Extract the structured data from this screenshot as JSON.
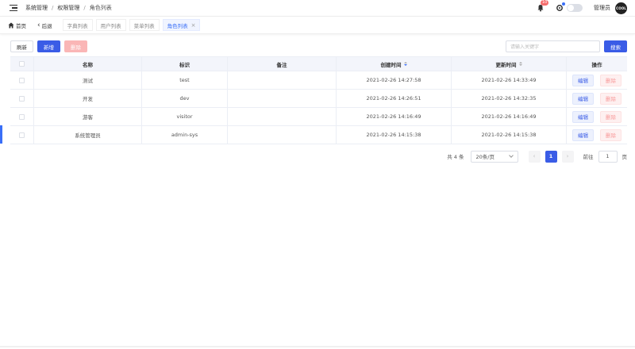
{
  "header": {
    "breadcrumb": [
      "系统管理",
      "权限管理",
      "角色列表"
    ],
    "notification_count": "10",
    "admin_name": "管理员",
    "avatar_text": "COOL"
  },
  "tabs": {
    "home": "首页",
    "back": "后退",
    "items": [
      "字典列表",
      "用户列表",
      "菜单列表",
      "角色列表"
    ],
    "active_index": 3
  },
  "toolbar": {
    "refresh_label": "刷新",
    "add_label": "新增",
    "delete_label": "删除",
    "search_placeholder": "请输入关键字",
    "search_label": "搜索"
  },
  "table": {
    "columns": [
      "名称",
      "标识",
      "备注",
      "创建时间",
      "更新时间",
      "操作"
    ],
    "rows": [
      {
        "name": "测试",
        "code": "test",
        "remark": "",
        "created": "2021-02-26 14:27:58",
        "updated": "2021-02-26 14:33:49"
      },
      {
        "name": "开发",
        "code": "dev",
        "remark": "",
        "created": "2021-02-26 14:26:51",
        "updated": "2021-02-26 14:32:35"
      },
      {
        "name": "游客",
        "code": "visitor",
        "remark": "",
        "created": "2021-02-26 14:16:49",
        "updated": "2021-02-26 14:16:49"
      },
      {
        "name": "系统管理员",
        "code": "admin-sys",
        "remark": "",
        "created": "2021-02-26 14:15:38",
        "updated": "2021-02-26 14:15:38"
      }
    ],
    "edit_label": "编辑",
    "delete_label": "删除"
  },
  "pagination": {
    "total_text": "共 4 条",
    "page_size": "20条/页",
    "current_page": "1",
    "goto_label": "前往",
    "goto_value": "1",
    "page_unit": "页"
  },
  "colors": {
    "primary": "#3a5ce6",
    "danger_light": "#fab6b6"
  }
}
